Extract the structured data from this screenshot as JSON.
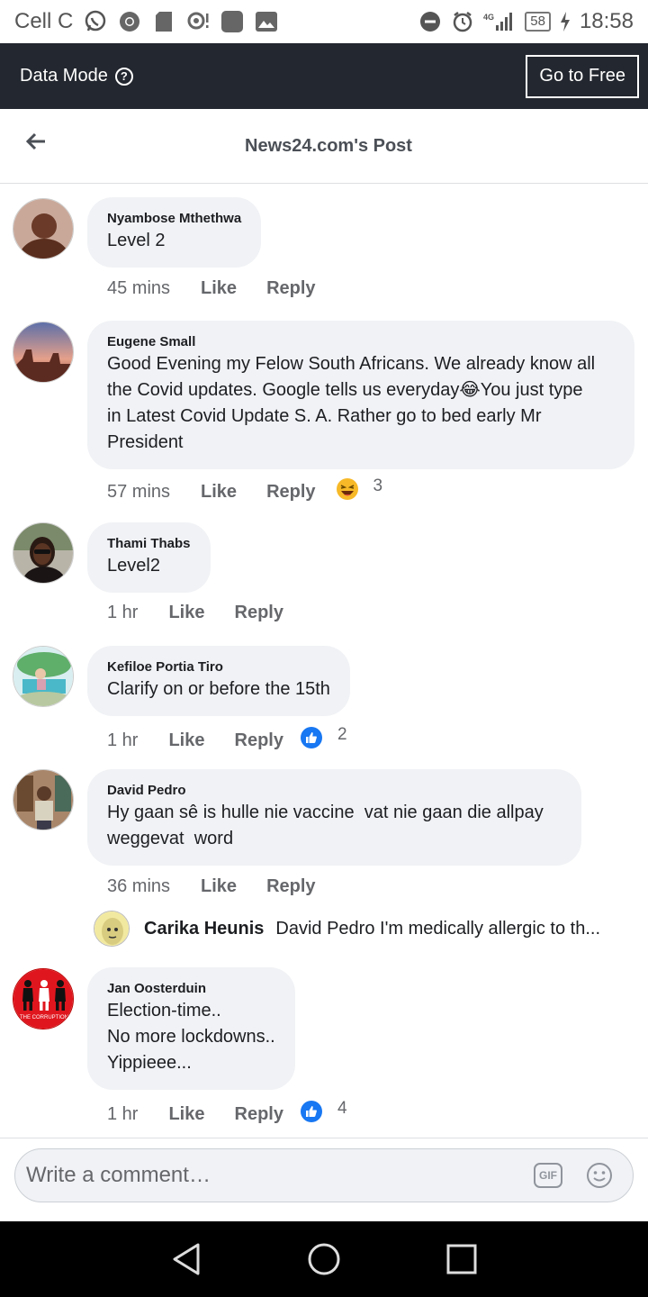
{
  "status_bar": {
    "carrier": "Cell C",
    "network": "4G",
    "battery": "58",
    "time": "18:58"
  },
  "data_bar": {
    "label": "Data Mode",
    "go_free_label": "Go to Free"
  },
  "header": {
    "title": "News24.com's Post"
  },
  "comments": [
    {
      "author": "Nyambose Mthethwa",
      "lines": [
        "Level 2"
      ],
      "time": "45 mins",
      "like": "Like",
      "reply": "Reply"
    },
    {
      "author": "Eugene Small",
      "lines": [
        "Good Evening my Felow South Africans. We already know all",
        "the Covid updates. Google tells us everyday😂You just type",
        "in Latest Covid Update S. A. Rather go to bed early Mr",
        "President"
      ],
      "time": "57 mins",
      "like": "Like",
      "reply": "Reply",
      "reaction_icon": "laugh-emoji-icon",
      "reaction_count": "3"
    },
    {
      "author": "Thami Thabs",
      "lines": [
        "Level2"
      ],
      "time": "1 hr",
      "like": "Like",
      "reply": "Reply"
    },
    {
      "author": "Kefiloe Portia Tiro",
      "lines": [
        "Clarify on or before the 15th"
      ],
      "time": "1 hr",
      "like": "Like",
      "reply": "Reply",
      "reaction_icon": "thumbs-up-icon",
      "reaction_count": "2"
    },
    {
      "author": "David Pedro",
      "lines": [
        "Hy gaan sê is hulle nie vaccine  vat nie gaan die allpay",
        "weggevat  word"
      ],
      "time": "36 mins",
      "like": "Like",
      "reply": "Reply"
    },
    {
      "author": "Jan Oosterduin",
      "lines": [
        "Election-time..",
        "No more lockdowns..",
        "Yippieee..."
      ],
      "time": "1 hr",
      "like": "Like",
      "reply": "Reply",
      "reaction_icon": "thumbs-up-icon",
      "reaction_count": "4"
    }
  ],
  "sub_reply": {
    "author": "Carika Heunis",
    "text": "David Pedro I'm medically allergic to th..."
  },
  "jan_avatar_caption": "THE CORRUPTION",
  "composer": {
    "placeholder": "Write a comment…",
    "gif_label": "GIF"
  },
  "colors": {
    "data_bar_bg": "#23272f",
    "bubble_bg": "#f0f2f5",
    "like_blue": "#1877f2"
  }
}
